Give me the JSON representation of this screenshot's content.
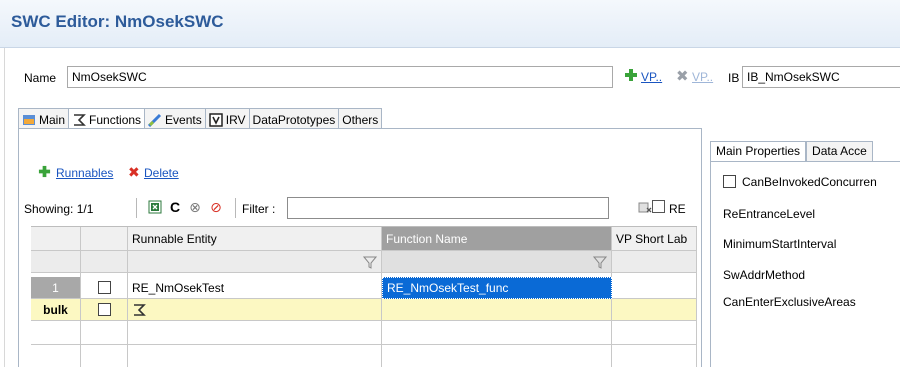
{
  "editor": {
    "title": "SWC Editor: NmOsekSWC"
  },
  "name_row": {
    "name_label": "Name",
    "name_value": "NmOsekSWC",
    "vp_add_label": "VP..",
    "vp_delete_label": "VP..",
    "ib_label": "IB",
    "ib_value": "IB_NmOsekSWC"
  },
  "tabs": [
    {
      "label": "Main",
      "icon": "main-icon"
    },
    {
      "label": "Functions",
      "icon": "functions-icon"
    },
    {
      "label": "Events",
      "icon": "events-icon"
    },
    {
      "label": "IRV",
      "icon": "irv-icon"
    },
    {
      "label": "DataPrototypes"
    },
    {
      "label": "Others"
    }
  ],
  "active_tab": "Functions",
  "functions": {
    "runnables_label": "Runnables",
    "delete_label": "Delete",
    "showing_label": "Showing: 1/1",
    "filter_label": "Filter :",
    "filter_value": "",
    "re_label": "RE",
    "columns": [
      "Runnable Entity",
      "Function Name",
      "VP Short Lab"
    ],
    "rows": [
      {
        "num": "1",
        "runnable_entity": "RE_NmOsekTest",
        "function_name": "RE_NmOsekTest_func",
        "vp_short_label": ""
      }
    ],
    "bulk_label": "bulk"
  },
  "side_panel": {
    "tabs": [
      "Main Properties",
      "Data Acce"
    ],
    "active_tab": "Main Properties",
    "properties": [
      "CanBeInvokedConcurren",
      "ReEntranceLevel",
      "MinimumStartInterval",
      "SwAddrMethod",
      "CanEnterExclusiveAreas"
    ]
  },
  "colors": {
    "title": "#2d5b9a",
    "link": "#1a55c0",
    "selection": "#0a6ad6",
    "bulk_row": "#fcf8c2",
    "add_icon": "#3aa33a",
    "delete_icon": "#d93025"
  }
}
